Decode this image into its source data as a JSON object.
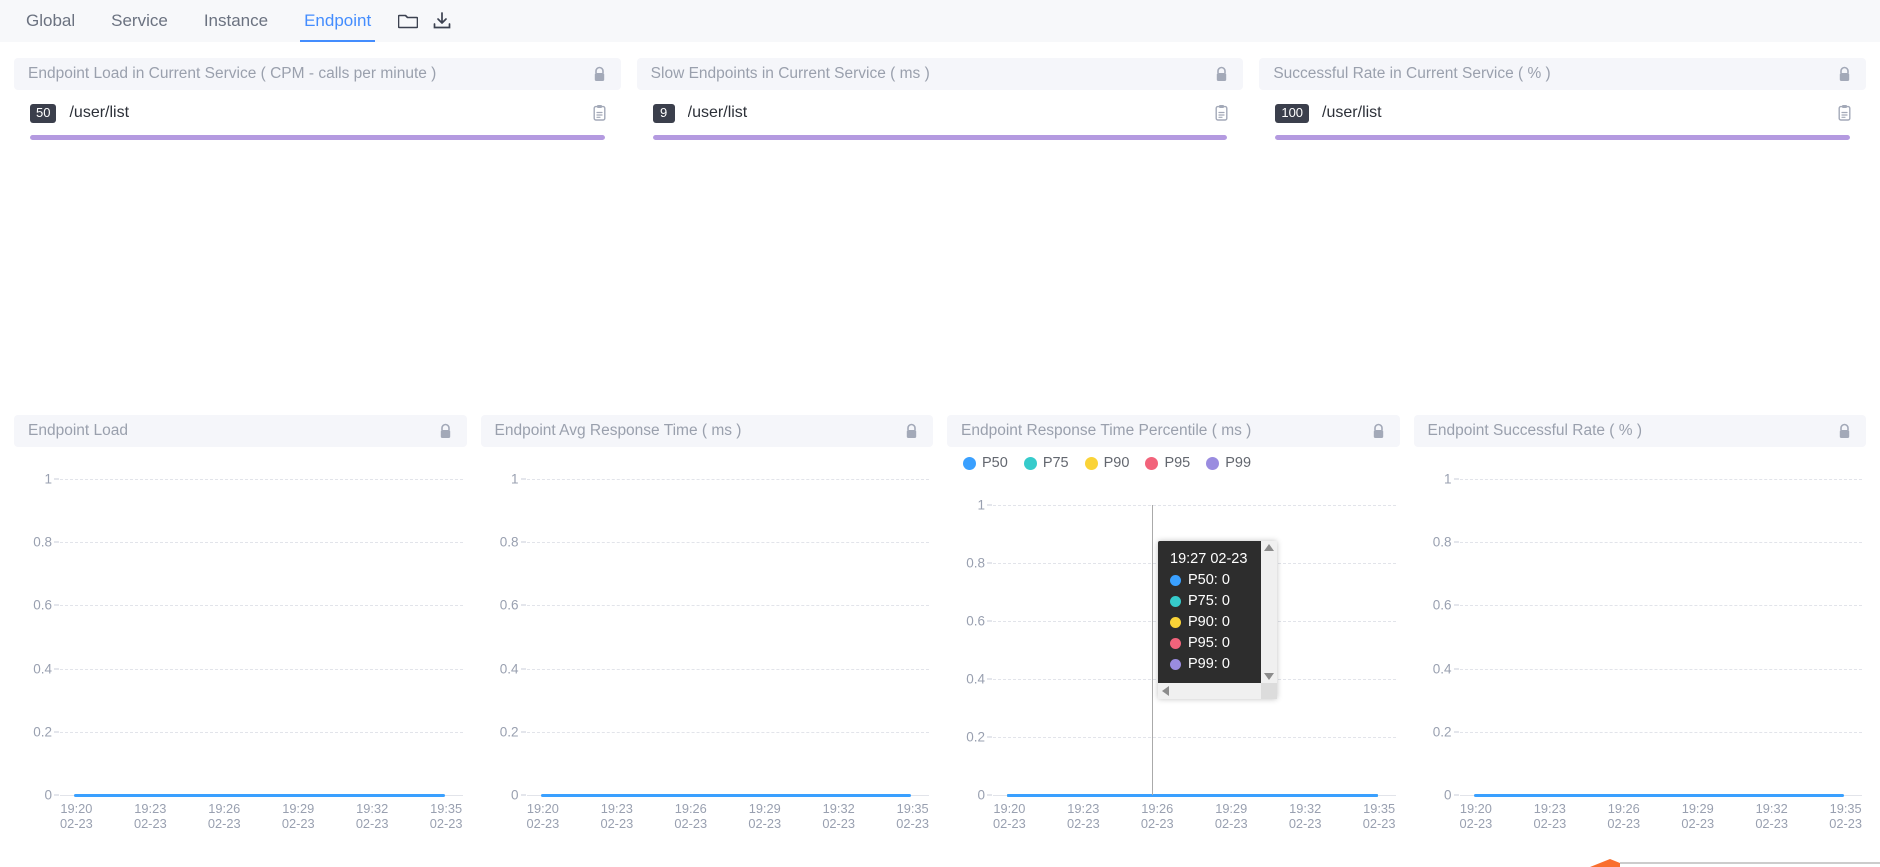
{
  "nav": {
    "tabs": [
      {
        "label": "Global",
        "active": false
      },
      {
        "label": "Service",
        "active": false
      },
      {
        "label": "Instance",
        "active": false
      },
      {
        "label": "Endpoint",
        "active": true
      }
    ],
    "icons": [
      {
        "name": "folder-icon"
      },
      {
        "name": "download-icon"
      }
    ],
    "active_color": "#448dfe"
  },
  "top_cards": [
    {
      "title": "Endpoint Load in Current Service ( CPM - calls per minute )",
      "lock_icon": "lock-icon",
      "copy_icon": "clipboard-icon",
      "value": "50",
      "endpoint": "/user/list",
      "bar_percent": 100,
      "bar_color": "#b49ae0"
    },
    {
      "title": "Slow Endpoints in Current Service ( ms )",
      "lock_icon": "lock-icon",
      "copy_icon": "clipboard-icon",
      "value": "9",
      "endpoint": "/user/list",
      "bar_percent": 100,
      "bar_color": "#b49ae0"
    },
    {
      "title": "Successful Rate in Current Service ( % )",
      "lock_icon": "lock-icon",
      "copy_icon": "clipboard-icon",
      "value": "100",
      "endpoint": "/user/list",
      "bar_percent": 100,
      "bar_color": "#b49ae0"
    }
  ],
  "chart_panels": [
    {
      "title": "Endpoint Load",
      "lock_icon": "lock-icon",
      "has_legend": false
    },
    {
      "title": "Endpoint Avg Response Time ( ms )",
      "lock_icon": "lock-icon",
      "has_legend": false
    },
    {
      "title": "Endpoint Response Time Percentile ( ms )",
      "lock_icon": "lock-icon",
      "has_legend": true
    },
    {
      "title": "Endpoint Successful Rate ( % )",
      "lock_icon": "lock-icon",
      "has_legend": false
    }
  ],
  "legend": [
    {
      "label": "P50",
      "color": "#3aa0ff"
    },
    {
      "label": "P75",
      "color": "#36cbcb"
    },
    {
      "label": "P90",
      "color": "#fad337"
    },
    {
      "label": "P95",
      "color": "#f2637b"
    },
    {
      "label": "P99",
      "color": "#975fe5"
    }
  ],
  "tooltip": {
    "title": "19:27 02-23",
    "rows": [
      {
        "label": "P50: 0",
        "color": "#3aa0ff"
      },
      {
        "label": "P75: 0",
        "color": "#36cbcb"
      },
      {
        "label": "P90: 0",
        "color": "#fad337"
      },
      {
        "label": "P95: 0",
        "color": "#f2637b"
      },
      {
        "label": "P99: 0",
        "color": "#9a8ce0"
      }
    ],
    "scroll_up_icon": "triangle-up-icon",
    "scroll_down_icon": "triangle-down-icon",
    "scroll_left_icon": "triangle-left-icon",
    "scroll_right_icon": "triangle-right-icon"
  },
  "chart_data": [
    {
      "type": "line",
      "title": "Endpoint Load",
      "xlabel": "",
      "ylabel": "",
      "ylim": [
        0,
        1
      ],
      "yticks": [
        "1",
        "0.8",
        "0.6",
        "0.4",
        "0.2",
        "0"
      ],
      "grid": true,
      "categories": [
        "19:20\n02-23",
        "19:23\n02-23",
        "19:26\n02-23",
        "19:29\n02-23",
        "19:32\n02-23",
        "19:35\n02-23"
      ],
      "x": [
        "19:20 02-23",
        "19:23 02-23",
        "19:26 02-23",
        "19:29 02-23",
        "19:32 02-23",
        "19:35 02-23"
      ],
      "series": [
        {
          "name": "Endpoint Load",
          "color": "#3aa0ff",
          "values": [
            0,
            0,
            0,
            0,
            0,
            0
          ]
        }
      ]
    },
    {
      "type": "line",
      "title": "Endpoint Avg Response Time ( ms )",
      "xlabel": "",
      "ylabel": "",
      "ylim": [
        0,
        1
      ],
      "yticks": [
        "1",
        "0.8",
        "0.6",
        "0.4",
        "0.2",
        "0"
      ],
      "grid": true,
      "x": [
        "19:20 02-23",
        "19:23 02-23",
        "19:26 02-23",
        "19:29 02-23",
        "19:32 02-23",
        "19:35 02-23"
      ],
      "series": [
        {
          "name": "Avg Response Time",
          "color": "#3aa0ff",
          "values": [
            0,
            0,
            0,
            0,
            0,
            0
          ]
        }
      ]
    },
    {
      "type": "line",
      "title": "Endpoint Response Time Percentile ( ms )",
      "xlabel": "",
      "ylabel": "",
      "ylim": [
        0,
        1
      ],
      "yticks": [
        "1",
        "0.8",
        "0.6",
        "0.4",
        "0.2",
        "0"
      ],
      "grid": true,
      "legend_position": "top-left",
      "annotation": "crosshair at 19:27 02-23",
      "x": [
        "19:20 02-23",
        "19:23 02-23",
        "19:26 02-23",
        "19:29 02-23",
        "19:32 02-23",
        "19:35 02-23"
      ],
      "series": [
        {
          "name": "P50",
          "color": "#3aa0ff",
          "values": [
            0,
            0,
            0,
            0,
            0,
            0
          ]
        },
        {
          "name": "P75",
          "color": "#36cbcb",
          "values": [
            0,
            0,
            0,
            0,
            0,
            0
          ]
        },
        {
          "name": "P90",
          "color": "#fad337",
          "values": [
            0,
            0,
            0,
            0,
            0,
            0
          ]
        },
        {
          "name": "P95",
          "color": "#f2637b",
          "values": [
            0,
            0,
            0,
            0,
            0,
            0
          ]
        },
        {
          "name": "P99",
          "color": "#975fe5",
          "values": [
            0,
            0,
            0,
            0,
            0,
            0
          ]
        }
      ]
    },
    {
      "type": "line",
      "title": "Endpoint Successful Rate ( % )",
      "xlabel": "",
      "ylabel": "",
      "ylim": [
        0,
        1
      ],
      "yticks": [
        "1",
        "0.8",
        "0.6",
        "0.4",
        "0.2",
        "0"
      ],
      "grid": true,
      "x": [
        "19:20 02-23",
        "19:23 02-23",
        "19:26 02-23",
        "19:29 02-23",
        "19:32 02-23",
        "19:35 02-23"
      ],
      "series": [
        {
          "name": "Successful Rate",
          "color": "#3aa0ff",
          "values": [
            0,
            0,
            0,
            0,
            0,
            0
          ]
        }
      ]
    }
  ]
}
